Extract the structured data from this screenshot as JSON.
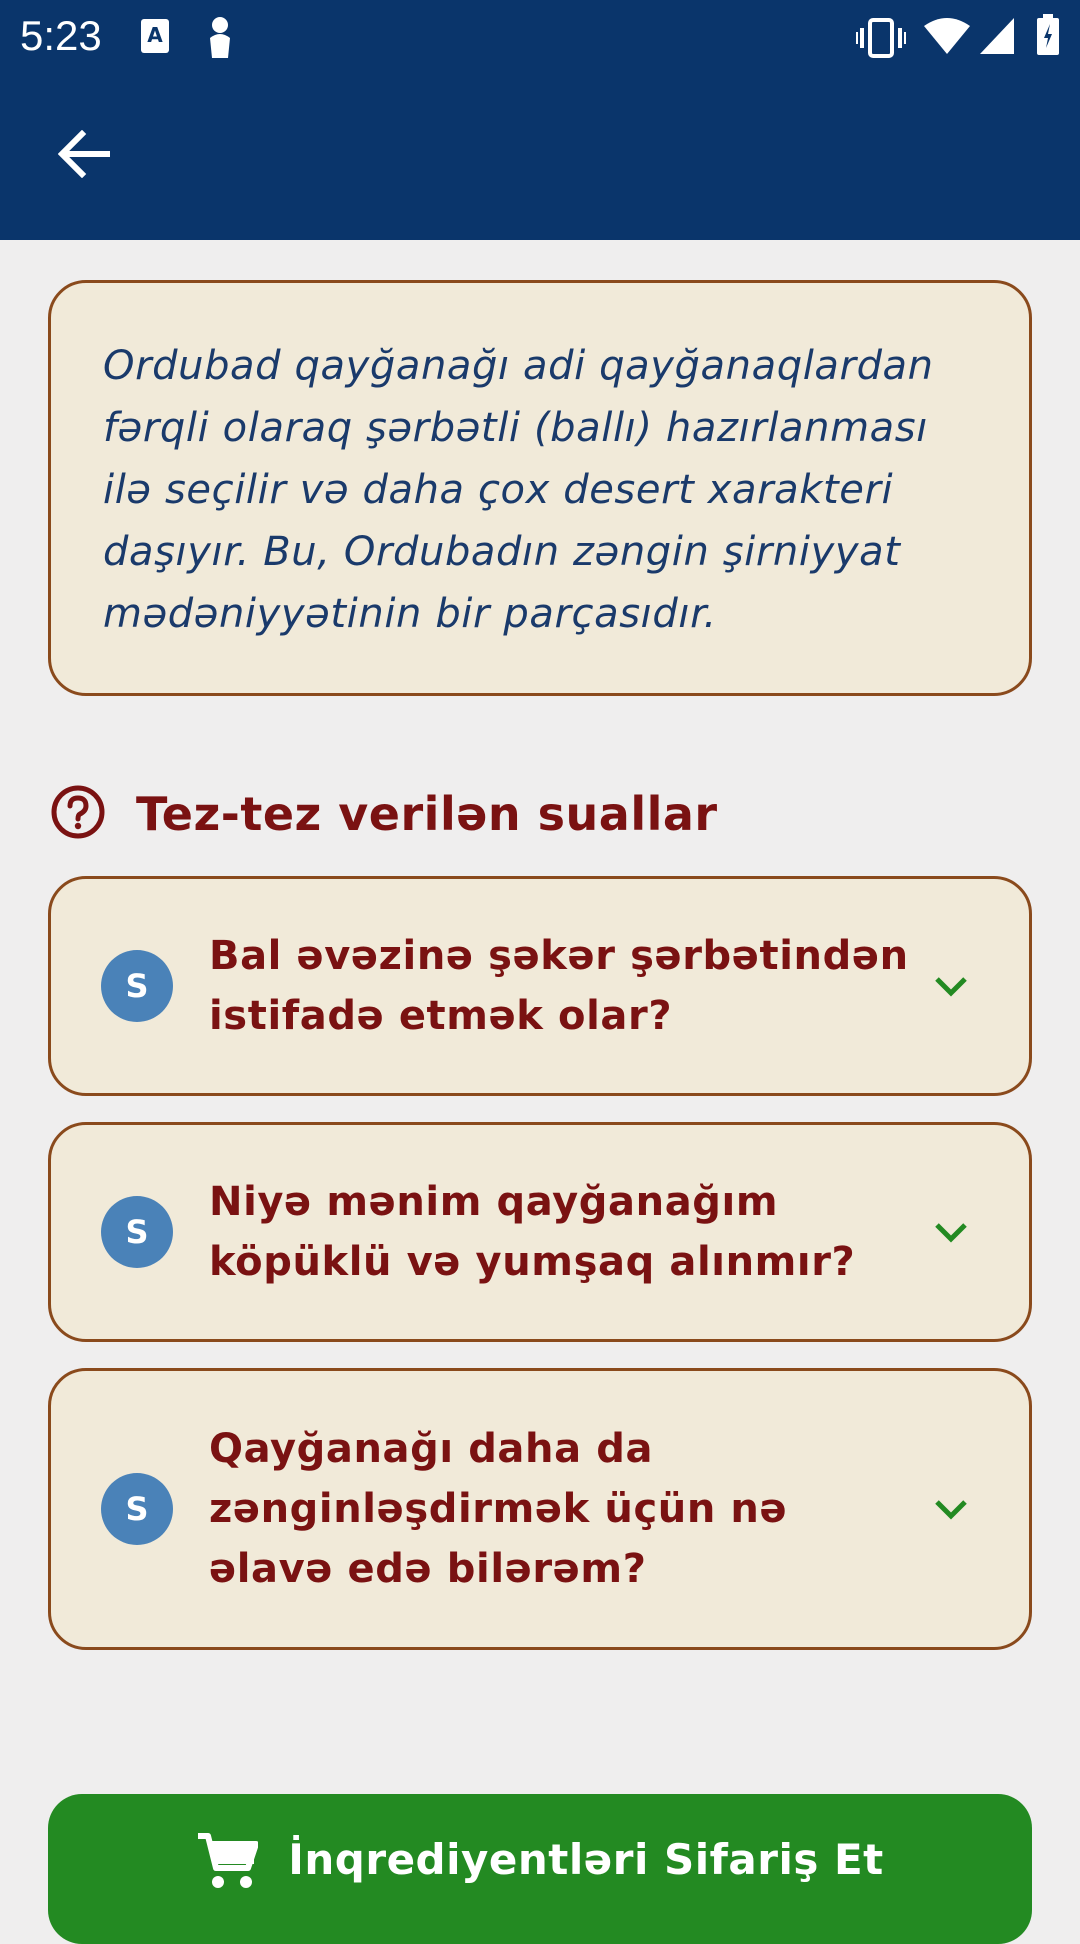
{
  "status_bar": {
    "time": "5:23",
    "icons": [
      "a-notification-icon",
      "person-icon",
      "vibrate-icon",
      "wifi-icon",
      "signal-icon",
      "battery-icon"
    ]
  },
  "app_bar": {
    "back_icon": "arrow-left-icon",
    "background_color": "#0a356b"
  },
  "intro": {
    "text": "Ordubad qayğanağı adi qayğanaqlardan fərqli olaraq şərbətli (ballı) hazırlanması ilə seçilir və daha çox desert xarakteri daşıyır. Bu, Ordubadın zəngin şirniyyat mədəniyyətinin bir parçasıdır."
  },
  "faq": {
    "icon": "question-circle-icon",
    "title": "Tez-tez verilən suallar",
    "items": [
      {
        "avatar": "S",
        "question": "Bal əvəzinə şəkər şərbətindən istifadə etmək olar?"
      },
      {
        "avatar": "S",
        "question": "Niyə mənim qayğanağım köpüklü və yumşaq alınmır?"
      },
      {
        "avatar": "S",
        "question": "Qayğanağı daha da zənginləşdirmək üçün nə əlavə edə bilərəm?"
      }
    ]
  },
  "order_button": {
    "icon": "cart-icon",
    "label": "İnqrediyentləri Sifariş Et",
    "color": "#238a22"
  }
}
